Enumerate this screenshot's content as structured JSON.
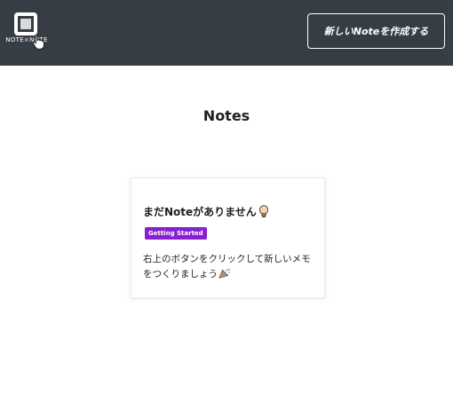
{
  "header": {
    "logo_text": "NOTE×NOTE",
    "logo_icon": "app-logo-square",
    "cursor_icon": "hand-pointer-icon",
    "create_button_label": "新しいNoteを作成する",
    "background_color": "#373d45"
  },
  "main": {
    "title": "Notes",
    "notes": [
      {
        "title": "まだNoteがありません",
        "title_icon": "light-bulb-icon",
        "tag": "Getting Started",
        "tag_color": "#8a1fd1",
        "body": "右上のボタンをクリックして新しいメモをつくりましょう",
        "body_icon": "party-popper-icon"
      }
    ]
  }
}
